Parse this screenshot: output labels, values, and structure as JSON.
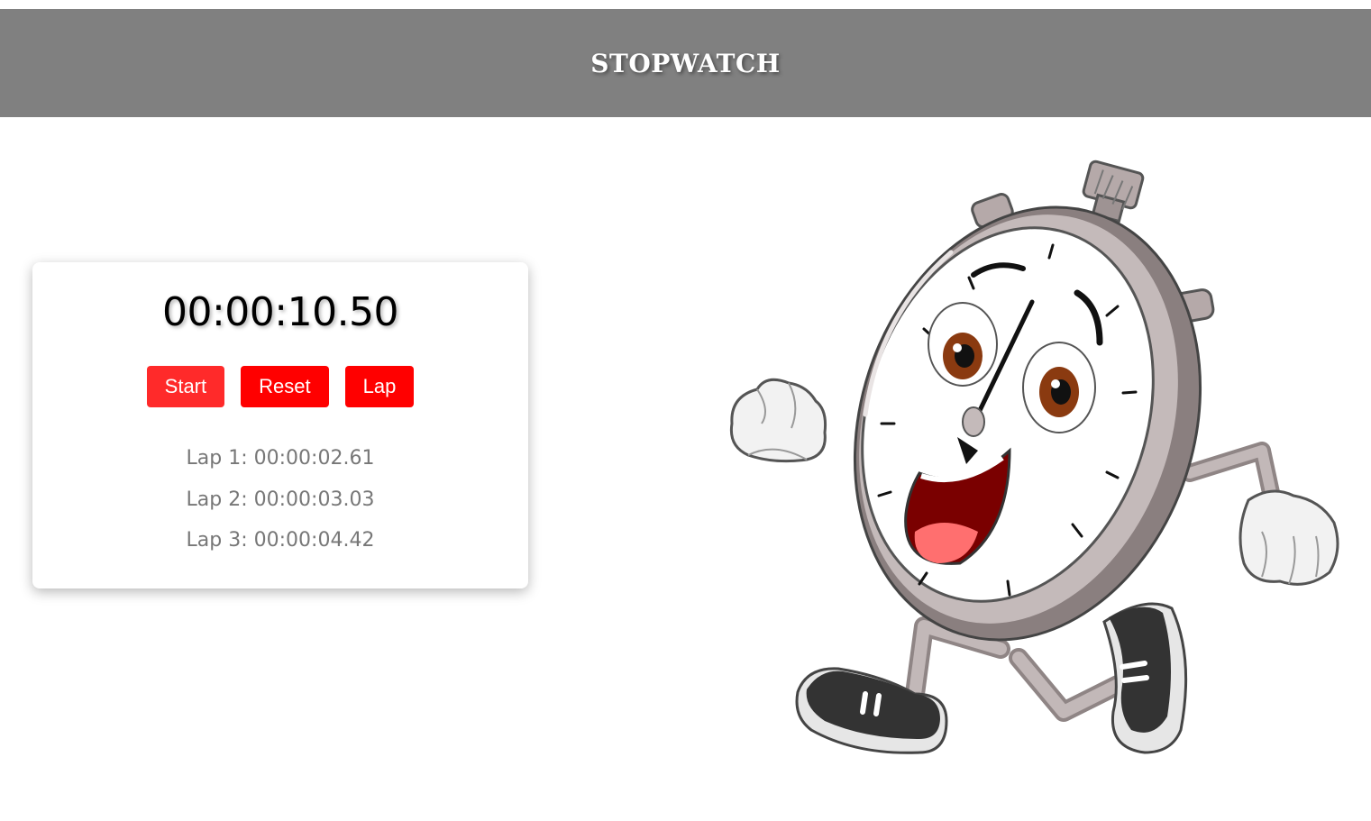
{
  "header": {
    "title": "STOPWATCH"
  },
  "stopwatch": {
    "display": "00:00:10.50",
    "buttons": {
      "start": "Start",
      "reset": "Reset",
      "lap": "Lap"
    },
    "laps": [
      "Lap 1: 00:00:02.61",
      "Lap 2: 00:00:03.03",
      "Lap 3: 00:00:04.42"
    ]
  },
  "colors": {
    "header_bg": "#808080",
    "button_red": "#ff0000",
    "lap_text": "#777777"
  },
  "icons": {
    "illustration": "running-stopwatch-mascot"
  }
}
